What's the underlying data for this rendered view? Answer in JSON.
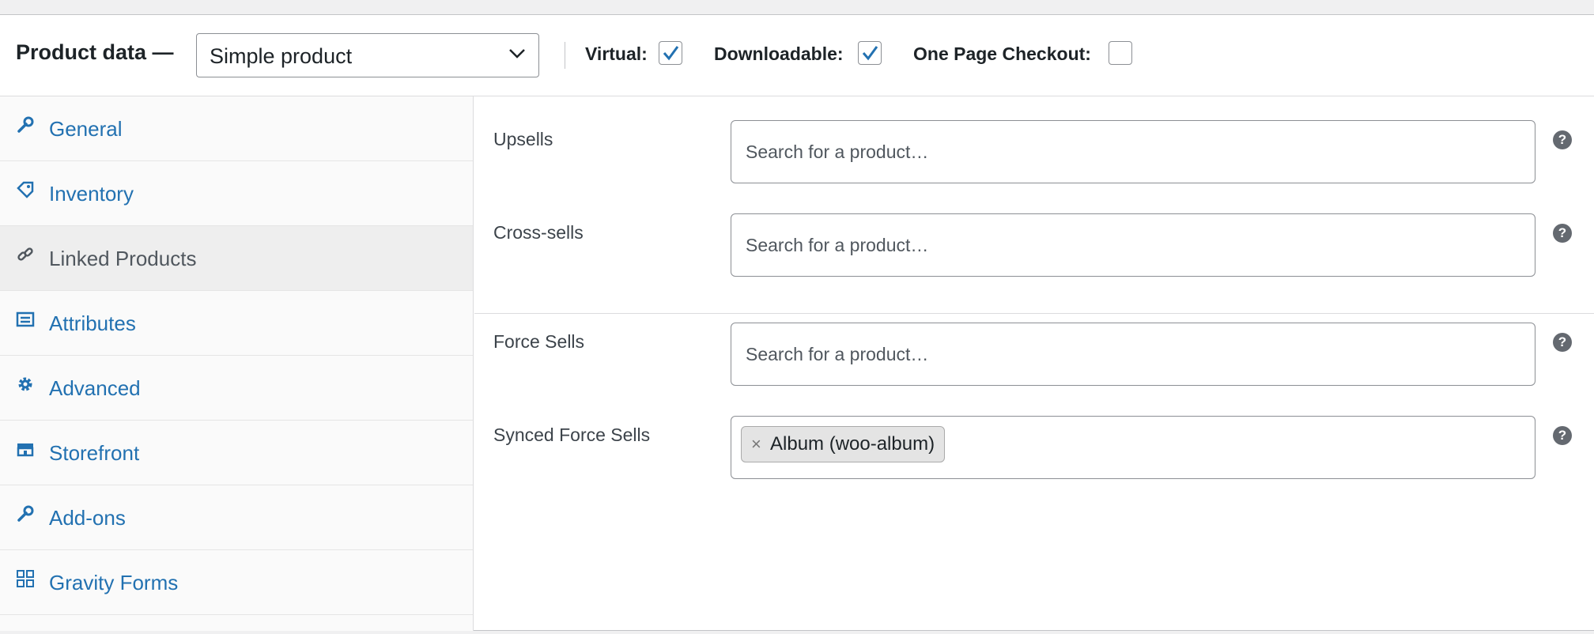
{
  "header": {
    "title": "Product data —",
    "product_type": "Simple product",
    "options": [
      {
        "label": "Virtual:",
        "checked": true
      },
      {
        "label": "Downloadable:",
        "checked": true
      },
      {
        "label": "One Page Checkout:",
        "checked": false
      }
    ]
  },
  "tabs": [
    {
      "label": "General",
      "icon": "wrench-icon"
    },
    {
      "label": "Inventory",
      "icon": "tag-icon"
    },
    {
      "label": "Linked Products",
      "icon": "link-icon",
      "active": true
    },
    {
      "label": "Attributes",
      "icon": "list-icon"
    },
    {
      "label": "Advanced",
      "icon": "gear-icon"
    },
    {
      "label": "Storefront",
      "icon": "store-icon"
    },
    {
      "label": "Add-ons",
      "icon": "wrench-icon"
    },
    {
      "label": "Gravity Forms",
      "icon": "grid-icon"
    }
  ],
  "fields": {
    "upsells": {
      "label": "Upsells",
      "placeholder": "Search for a product…"
    },
    "cross_sells": {
      "label": "Cross-sells",
      "placeholder": "Search for a product…"
    },
    "force_sells": {
      "label": "Force Sells",
      "placeholder": "Search for a product…"
    },
    "synced_force_sells": {
      "label": "Synced Force Sells",
      "token": "Album (woo-album)",
      "token_remove": "×"
    }
  },
  "help_glyph": "?",
  "colors": {
    "link": "#2271b1",
    "active_tab_bg": "#eeeeee",
    "border": "#8c8f94",
    "checkmark": "#2271b1"
  }
}
